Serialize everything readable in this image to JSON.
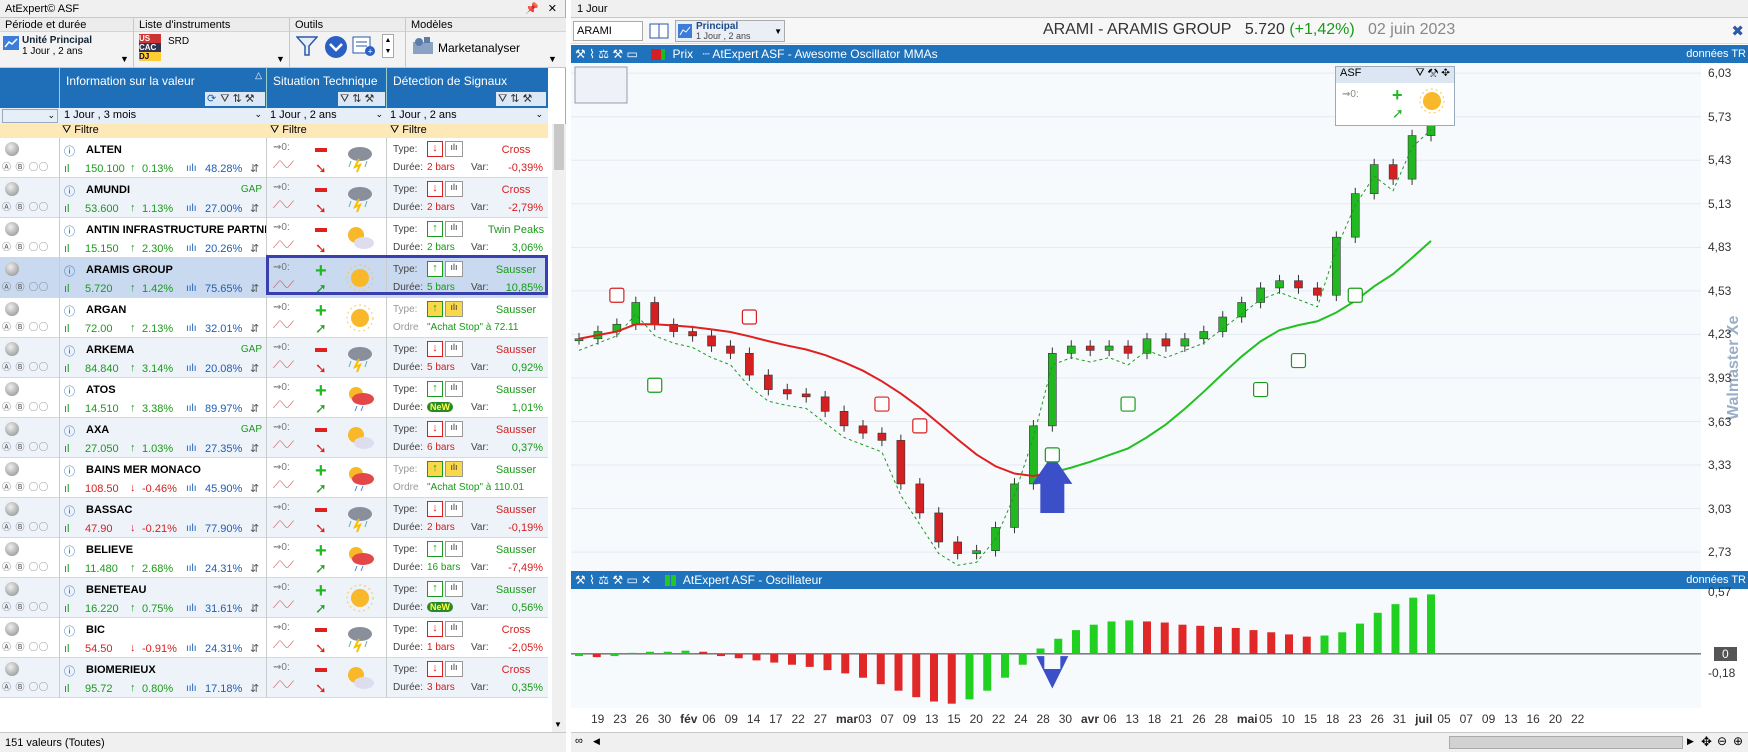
{
  "window": {
    "title": "AtExpert© ASF",
    "pin_icon": "pin-icon",
    "close_icon": "close-icon"
  },
  "toolbar": {
    "period": {
      "header": "Période et durée",
      "unit": "Unité Principal",
      "duration": "1 Jour , 2 ans"
    },
    "instruments": {
      "header": "Liste d'instruments",
      "items": [
        "US",
        "CAC",
        "DJ"
      ],
      "selected": "SRD"
    },
    "tools": {
      "header": "Outils"
    },
    "models": {
      "header": "Modèles",
      "label": "Marketanalyser"
    }
  },
  "grid": {
    "columns": [
      "Information sur la valeur",
      "Situation Technique",
      "Détection de Signaux"
    ],
    "periods": [
      "1 Jour , 3 mois",
      "1 Jour , 2 ans",
      "1 Jour , 2 ans"
    ],
    "filter": "Filtre",
    "label_type": "Type:",
    "label_duree": "Durée:",
    "label_var": "Var:",
    "label_ordre": "Ordre",
    "rows": [
      {
        "name": "ALTEN",
        "price": "150.100",
        "dir": "up",
        "chg": "0.13%",
        "vol": "48.28%",
        "signal": "Cross",
        "dur": "2 bars",
        "var": "-0,39%",
        "tech": "minus",
        "weather": "storm",
        "gap": "",
        "sig_dir": "down"
      },
      {
        "name": "AMUNDI",
        "price": "53.600",
        "dir": "up",
        "chg": "1.13%",
        "vol": "27.00%",
        "signal": "Cross",
        "dur": "2 bars",
        "var": "-2,79%",
        "tech": "minus",
        "weather": "storm",
        "gap": "GAP",
        "sig_dir": "down"
      },
      {
        "name": "ANTIN INFRASTRUCTURE PARTNERS",
        "price": "15.150",
        "dir": "up",
        "chg": "2.30%",
        "vol": "20.26%",
        "signal": "Twin Peaks",
        "dur": "2 bars",
        "var": "3,06%",
        "tech": "minus",
        "weather": "suncloud",
        "gap": "",
        "sig_dir": "up"
      },
      {
        "name": "ARAMIS GROUP",
        "price": "5.720",
        "dir": "up",
        "chg": "1.42%",
        "vol": "75.65%",
        "signal": "Sausser",
        "dur": "5 bars",
        "var": "10,85%",
        "tech": "plus",
        "weather": "sun",
        "gap": "",
        "sig_dir": "up"
      },
      {
        "name": "ARGAN",
        "price": "72.00",
        "dir": "up",
        "chg": "2.13%",
        "vol": "32.01%",
        "signal": "Sausser",
        "dur": "\"Achat Stop\" à 72.11",
        "var": "",
        "tech": "plus",
        "weather": "sun",
        "gap": "",
        "sig_dir": "up",
        "order": true
      },
      {
        "name": "ARKEMA",
        "price": "84.840",
        "dir": "up",
        "chg": "3.14%",
        "vol": "20.08%",
        "signal": "Sausser",
        "dur": "5 bars",
        "var": "0,92%",
        "tech": "minus",
        "weather": "storm",
        "gap": "GAP",
        "sig_dir": "down"
      },
      {
        "name": "ATOS",
        "price": "14.510",
        "dir": "up",
        "chg": "3.38%",
        "vol": "89.97%",
        "signal": "Sausser",
        "dur": "NeW",
        "var": "1,01%",
        "tech": "plus",
        "weather": "rain",
        "gap": "",
        "sig_dir": "up"
      },
      {
        "name": "AXA",
        "price": "27.050",
        "dir": "up",
        "chg": "1.03%",
        "vol": "27.35%",
        "signal": "Sausser",
        "dur": "6 bars",
        "var": "0,37%",
        "tech": "minus",
        "weather": "suncloud",
        "gap": "GAP",
        "sig_dir": "down"
      },
      {
        "name": "BAINS MER MONACO",
        "price": "108.50",
        "dir": "down",
        "chg": "-0.46%",
        "vol": "45.90%",
        "signal": "Sausser",
        "dur": "\"Achat Stop\" à 110.01",
        "var": "",
        "tech": "plus",
        "weather": "rain",
        "gap": "",
        "sig_dir": "up",
        "order": true
      },
      {
        "name": "BASSAC",
        "price": "47.90",
        "dir": "down",
        "chg": "-0.21%",
        "vol": "77.90%",
        "signal": "Sausser",
        "dur": "2 bars",
        "var": "-0,19%",
        "tech": "minus",
        "weather": "storm",
        "gap": "",
        "sig_dir": "down"
      },
      {
        "name": "BELIEVE",
        "price": "11.480",
        "dir": "up",
        "chg": "2.68%",
        "vol": "24.31%",
        "signal": "Sausser",
        "dur": "16 bars",
        "var": "-7,49%",
        "tech": "plus",
        "weather": "rain",
        "gap": "",
        "sig_dir": "up"
      },
      {
        "name": "BENETEAU",
        "price": "16.220",
        "dir": "up",
        "chg": "0.75%",
        "vol": "31.61%",
        "signal": "Sausser",
        "dur": "NeW",
        "var": "0,56%",
        "tech": "plus",
        "weather": "sun",
        "gap": "",
        "sig_dir": "up"
      },
      {
        "name": "BIC",
        "price": "54.50",
        "dir": "down",
        "chg": "-0.91%",
        "vol": "24.31%",
        "signal": "Cross",
        "dur": "1 bars",
        "var": "-2,05%",
        "tech": "minus",
        "weather": "storm",
        "gap": "",
        "sig_dir": "down"
      },
      {
        "name": "BIOMERIEUX",
        "price": "95.72",
        "dir": "up",
        "chg": "0.80%",
        "vol": "17.18%",
        "signal": "Cross",
        "dur": "3 bars",
        "var": "0,35%",
        "tech": "minus",
        "weather": "suncloud",
        "gap": "",
        "sig_dir": "down"
      }
    ],
    "status": "151 valeurs (Toutes)"
  },
  "chart": {
    "window_title": "1 Jour",
    "symbol": "ARAMI",
    "header": "ARAMI - ARAMIS GROUP",
    "price": "5.720",
    "change": "(+1,42%)",
    "date": "02 juin 2023",
    "layout_label": "Principal",
    "layout_sub": "1 Jour , 2 ans",
    "legend_price": "Prix",
    "legend_indicator": "AtExpert ASF - Awesome Oscillator MMAs",
    "osc_title": "AtExpert ASF - Oscillateur",
    "data_label": "données TR",
    "asf_box": "ASF",
    "watermark": "Walmaster Xe",
    "y_ticks": [
      "6,03",
      "5,73",
      "5,43",
      "5,13",
      "4,83",
      "4,53",
      "4,23",
      "3,93",
      "3,63",
      "3,33",
      "3,03",
      "2,73"
    ],
    "osc_ticks": [
      "0,57",
      "0",
      "-0,18"
    ],
    "x_ticks": [
      "19",
      "23",
      "26",
      "30",
      "fév",
      "06",
      "09",
      "14",
      "17",
      "22",
      "27",
      "mar",
      "03",
      "07",
      "09",
      "13",
      "15",
      "20",
      "22",
      "24",
      "28",
      "30",
      "avr",
      "06",
      "13",
      "18",
      "21",
      "26",
      "28",
      "mai",
      "05",
      "10",
      "15",
      "18",
      "23",
      "26",
      "31",
      "juil",
      "05",
      "07",
      "09",
      "13",
      "16",
      "20",
      "22"
    ]
  },
  "chart_data": [
    {
      "type": "line",
      "title": "ARAMI - ARAMIS GROUP",
      "ylim": [
        2.6,
        6.1
      ],
      "series": [
        {
          "name": "Prix",
          "values": [
            4.2,
            4.25,
            4.3,
            4.45,
            4.3,
            4.25,
            4.22,
            4.15,
            4.1,
            3.95,
            3.85,
            3.82,
            3.8,
            3.7,
            3.6,
            3.55,
            3.5,
            3.2,
            3.0,
            2.8,
            2.72,
            2.74,
            2.9,
            3.2,
            3.6,
            4.1,
            4.15,
            4.12,
            4.15,
            4.1,
            4.2,
            4.15,
            4.2,
            4.25,
            4.35,
            4.45,
            4.55,
            4.6,
            4.55,
            4.5,
            4.9,
            5.2,
            5.4,
            5.3,
            5.6,
            5.72
          ]
        }
      ]
    },
    {
      "type": "bar",
      "title": "AtExpert ASF - Oscillateur",
      "ylim": [
        -0.5,
        0.6
      ],
      "values": [
        -0.02,
        -0.03,
        -0.02,
        0.01,
        0.02,
        0.02,
        0.03,
        0.02,
        -0.02,
        -0.04,
        -0.06,
        -0.08,
        -0.1,
        -0.12,
        -0.15,
        -0.18,
        -0.22,
        -0.28,
        -0.34,
        -0.4,
        -0.44,
        -0.46,
        -0.42,
        -0.34,
        -0.22,
        -0.1,
        0.05,
        0.14,
        0.22,
        0.27,
        0.3,
        0.31,
        0.3,
        0.29,
        0.27,
        0.26,
        0.25,
        0.24,
        0.22,
        0.2,
        0.18,
        0.16,
        0.17,
        0.2,
        0.28,
        0.38,
        0.46,
        0.52,
        0.55
      ]
    }
  ]
}
